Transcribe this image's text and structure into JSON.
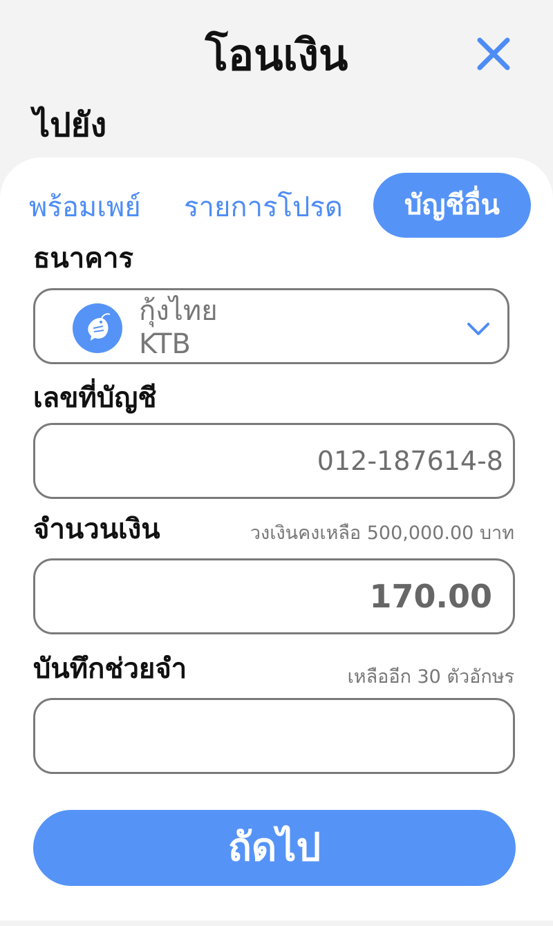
{
  "header": {
    "title": "โอนเงิน",
    "to_label": "ไปยัง"
  },
  "tabs": [
    {
      "label": "พร้อมเพย์",
      "active": false
    },
    {
      "label": "รายการโปรด",
      "active": false
    },
    {
      "label": "บัญชีอื่น",
      "active": true
    }
  ],
  "form": {
    "bank_label": "ธนาคาร",
    "bank": {
      "name": "กุ้งไทย",
      "code": "KTB",
      "logo_icon": "shrimp-icon"
    },
    "account_label": "เลขที่บัญชี",
    "account_value": "012-187614-8",
    "amount_label": "จำนวนเงิน",
    "balance_hint": "วงเงินคงเหลือ 500,000.00 บาท",
    "amount_value": "170.00",
    "memo_label": "บันทึกช่วยจำ",
    "remaining_hint": "เหลืออีก 30 ตัวอักษร",
    "memo_value": ""
  },
  "actions": {
    "next_label": "ถัดไป"
  },
  "colors": {
    "accent": "#5593f7",
    "tab_text": "#4e8cf5",
    "border": "#7a7a7a",
    "background": "#f3f3f3"
  }
}
